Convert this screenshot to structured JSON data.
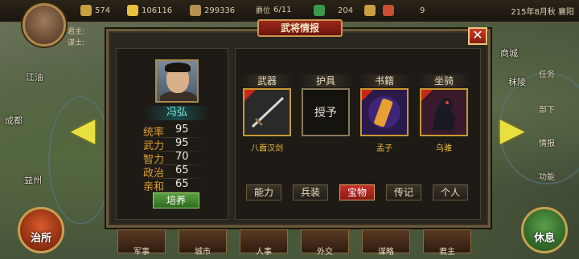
{
  "topbar": {
    "resources": [
      {
        "icon": "coin-icon",
        "value": "574"
      },
      {
        "icon": "gold-icon",
        "value": "106116"
      },
      {
        "icon": "grain-icon",
        "value": "299336"
      }
    ],
    "rank_label": "爵位",
    "rank_value": "6/11",
    "item1_value": "204",
    "item2_value": "9",
    "date": "215年8月秋 襄阳"
  },
  "player": {
    "lord_label": "君主:",
    "advisor_label": "谋士:"
  },
  "map": {
    "cities": [
      "江油",
      "成都",
      "益州",
      "商城",
      "秣陵"
    ],
    "side_buttons": [
      "任务",
      "部下",
      "情报",
      "功能"
    ]
  },
  "bottom": {
    "buttons": [
      "军事",
      "城市",
      "人事",
      "外交",
      "谋略",
      "君主"
    ],
    "left_round": "治所",
    "right_round": "休息"
  },
  "dialog": {
    "title": "武将情报",
    "close": "✕",
    "general": {
      "name": "冯弘",
      "stats": [
        {
          "label": "统率",
          "value": "95"
        },
        {
          "label": "武力",
          "value": "95"
        },
        {
          "label": "智力",
          "value": "70"
        },
        {
          "label": "政治",
          "value": "65"
        },
        {
          "label": "亲和",
          "value": "65"
        }
      ],
      "train_button": "培养"
    },
    "slots": [
      {
        "header": "武器",
        "item": "八面汉剑"
      },
      {
        "header": "护具",
        "empty_label": "授予"
      },
      {
        "header": "书籍",
        "item": "孟子"
      },
      {
        "header": "坐骑",
        "item": "乌骓"
      }
    ],
    "tabs": [
      "能力",
      "兵装",
      "宝物",
      "传记",
      "个人"
    ],
    "active_tab": "宝物"
  }
}
